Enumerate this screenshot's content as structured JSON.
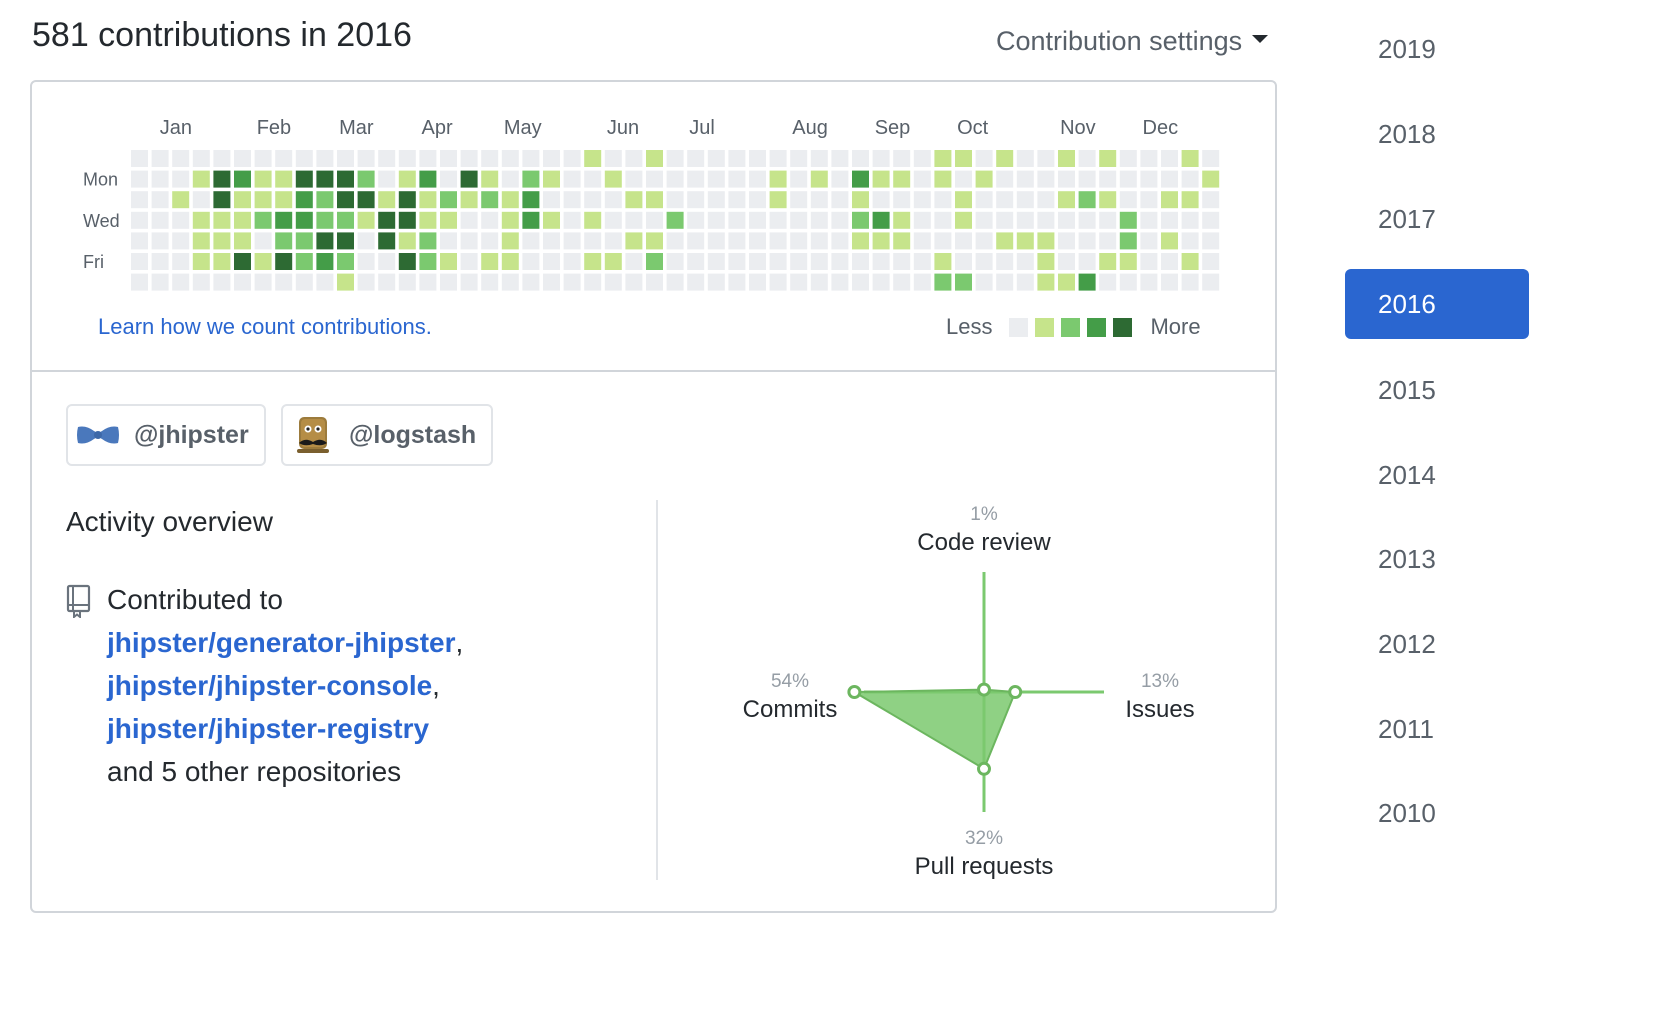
{
  "header": {
    "title": "581 contributions in 2016",
    "settings_label": "Contribution settings"
  },
  "calendar": {
    "months": [
      "Jan",
      "Feb",
      "Mar",
      "Apr",
      "May",
      "Jun",
      "Jul",
      "Aug",
      "Sep",
      "Oct",
      "Nov",
      "Dec"
    ],
    "day_labels": [
      "Mon",
      "Wed",
      "Fri"
    ],
    "colors": [
      "#ebedf0",
      "#c6e48b",
      "#7bc96f",
      "#449d48",
      "#2d6a33"
    ],
    "weeks": [
      [
        0,
        0,
        0,
        0,
        0,
        0,
        0
      ],
      [
        0,
        0,
        0,
        0,
        0,
        0,
        0
      ],
      [
        0,
        0,
        1,
        0,
        0,
        0,
        0
      ],
      [
        0,
        1,
        0,
        1,
        1,
        1,
        0
      ],
      [
        0,
        4,
        4,
        1,
        1,
        1,
        0
      ],
      [
        0,
        3,
        1,
        1,
        1,
        4,
        0
      ],
      [
        0,
        1,
        1,
        2,
        0,
        1,
        0
      ],
      [
        0,
        1,
        1,
        3,
        2,
        4,
        0
      ],
      [
        0,
        4,
        3,
        3,
        2,
        2,
        0
      ],
      [
        0,
        4,
        2,
        2,
        4,
        3,
        0
      ],
      [
        0,
        4,
        4,
        2,
        4,
        2,
        1
      ],
      [
        0,
        2,
        4,
        1,
        0,
        0,
        0
      ],
      [
        0,
        0,
        1,
        4,
        4,
        0,
        0
      ],
      [
        0,
        1,
        4,
        4,
        1,
        4,
        0
      ],
      [
        0,
        3,
        1,
        1,
        2,
        2,
        0
      ],
      [
        0,
        0,
        2,
        1,
        0,
        1,
        0
      ],
      [
        0,
        4,
        1,
        0,
        0,
        0,
        0
      ],
      [
        0,
        1,
        2,
        0,
        0,
        1,
        0
      ],
      [
        0,
        0,
        1,
        1,
        1,
        1,
        0
      ],
      [
        0,
        2,
        3,
        3,
        0,
        0,
        0
      ],
      [
        0,
        1,
        0,
        1,
        0,
        0,
        0
      ],
      [
        0,
        0,
        0,
        0,
        0,
        0,
        0
      ],
      [
        1,
        0,
        0,
        1,
        0,
        1,
        0
      ],
      [
        0,
        1,
        0,
        0,
        0,
        1,
        0
      ],
      [
        0,
        0,
        1,
        0,
        1,
        0,
        0
      ],
      [
        1,
        0,
        1,
        0,
        1,
        2,
        0
      ],
      [
        0,
        0,
        0,
        2,
        0,
        0,
        0
      ],
      [
        0,
        0,
        0,
        0,
        0,
        0,
        0
      ],
      [
        0,
        0,
        0,
        0,
        0,
        0,
        0
      ],
      [
        0,
        0,
        0,
        0,
        0,
        0,
        0
      ],
      [
        0,
        0,
        0,
        0,
        0,
        0,
        0
      ],
      [
        0,
        1,
        1,
        0,
        0,
        0,
        0
      ],
      [
        0,
        0,
        0,
        0,
        0,
        0,
        0
      ],
      [
        0,
        1,
        0,
        0,
        0,
        0,
        0
      ],
      [
        0,
        0,
        0,
        0,
        0,
        0,
        0
      ],
      [
        0,
        3,
        1,
        2,
        1,
        0,
        0
      ],
      [
        0,
        1,
        0,
        3,
        1,
        0,
        0
      ],
      [
        0,
        1,
        0,
        1,
        1,
        0,
        0
      ],
      [
        0,
        0,
        0,
        0,
        0,
        0,
        0
      ],
      [
        1,
        1,
        0,
        0,
        0,
        1,
        2
      ],
      [
        1,
        0,
        1,
        1,
        0,
        0,
        2
      ],
      [
        0,
        1,
        0,
        0,
        0,
        0,
        0
      ],
      [
        1,
        0,
        0,
        0,
        1,
        0,
        0
      ],
      [
        0,
        0,
        0,
        0,
        1,
        0,
        0
      ],
      [
        0,
        0,
        0,
        0,
        1,
        1,
        1
      ],
      [
        1,
        0,
        1,
        0,
        0,
        0,
        1
      ],
      [
        0,
        0,
        2,
        0,
        0,
        0,
        3
      ],
      [
        1,
        0,
        1,
        0,
        0,
        1,
        0
      ],
      [
        0,
        0,
        0,
        2,
        2,
        1,
        0
      ],
      [
        0,
        0,
        0,
        0,
        0,
        0,
        0
      ],
      [
        0,
        0,
        1,
        0,
        1,
        0,
        0
      ],
      [
        1,
        0,
        1,
        0,
        0,
        1,
        0
      ],
      [
        0,
        1,
        0,
        0,
        0,
        0,
        0
      ]
    ]
  },
  "learn_link": "Learn how we count contributions.",
  "legend": {
    "less": "Less",
    "more": "More"
  },
  "orgs": [
    {
      "handle": "@jhipster",
      "icon": "bowtie-icon"
    },
    {
      "handle": "@logstash",
      "icon": "log-mascot-icon"
    }
  ],
  "activity": {
    "title": "Activity overview",
    "contributed_to": "Contributed to",
    "repos": [
      "jhipster/generator-jhipster",
      "jhipster/jhipster-console",
      "jhipster/jhipster-registry"
    ],
    "separator": ",",
    "other": "and 5 other repositories"
  },
  "radar": {
    "code_review": {
      "label": "Code review",
      "pct": "1%",
      "value": 1
    },
    "issues": {
      "label": "Issues",
      "pct": "13%",
      "value": 13
    },
    "pull_requests": {
      "label": "Pull requests",
      "pct": "32%",
      "value": 32
    },
    "commits": {
      "label": "Commits",
      "pct": "54%",
      "value": 54
    },
    "color": "#7bc96f"
  },
  "years": [
    "2019",
    "2018",
    "2017",
    "2016",
    "2015",
    "2014",
    "2013",
    "2012",
    "2011",
    "2010"
  ],
  "selected_year": "2016",
  "colors": {
    "accent": "#2a66d0",
    "link": "#2a66d0"
  }
}
